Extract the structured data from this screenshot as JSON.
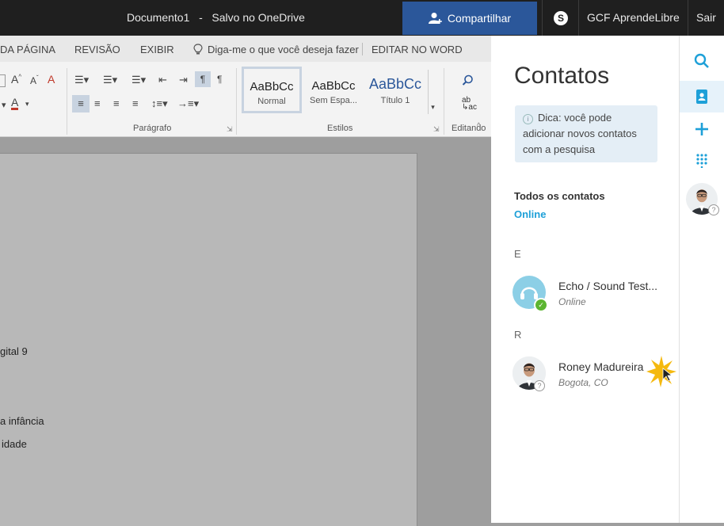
{
  "titlebar": {
    "doc_name": "Documento1",
    "separator": "-",
    "save_status": "Salvo no OneDrive",
    "share_label": "Compartilhar",
    "user_name": "GCF AprendeLibre",
    "signout_label": "Sair"
  },
  "ribbon": {
    "tabs": [
      "DA PÁGINA",
      "REVISÃO",
      "EXIBIR",
      "Diga-me o que você deseja fazer",
      "EDITAR NO WORD"
    ],
    "groups": {
      "paragraph": "Parágrafo",
      "styles": "Estilos",
      "editing": "Editando"
    },
    "styles": [
      {
        "sample": "AaBbCc",
        "name": "Normal"
      },
      {
        "sample": "AaBbCc",
        "name": "Sem Espa..."
      },
      {
        "sample": "AaBbCc",
        "name": "Título 1"
      }
    ]
  },
  "document": {
    "lines": [
      "gital 9",
      "a infância",
      "idade"
    ]
  },
  "contacts_panel": {
    "title": "Contatos",
    "tip": "Dica: você pode adicionar novos contatos com a pesquisa",
    "all_contacts_label": "Todos os contatos",
    "online_filter": "Online",
    "groups": [
      {
        "letter": "E",
        "contacts": [
          {
            "name": "Echo / Sound Test...",
            "status": "Online"
          }
        ]
      },
      {
        "letter": "R",
        "contacts": [
          {
            "name": "Roney Madureira",
            "status": "Bogota, CO"
          }
        ]
      }
    ]
  },
  "rail": {
    "icons": [
      "search-icon",
      "contacts-icon",
      "add-icon",
      "dialpad-icon",
      "profile-avatar"
    ]
  },
  "colors": {
    "accent": "#1ea0d8",
    "share": "#2b579a",
    "titlebar": "#1f1f1f",
    "online": "#5cb531"
  }
}
